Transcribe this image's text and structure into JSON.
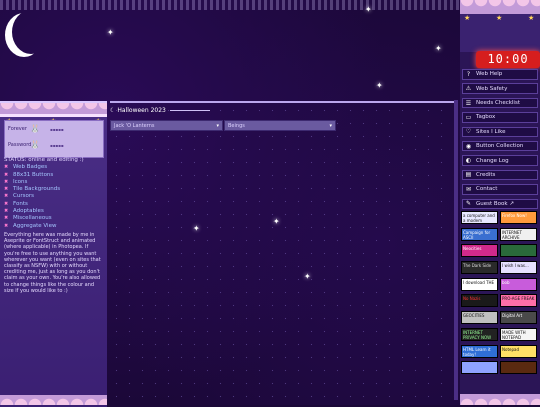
{
  "clock": "10:00 PM",
  "center": {
    "title": "Halloween 2023",
    "select_left": "Jack 'O Lanterns",
    "select_right": "Beings"
  },
  "login": {
    "user_label": "Forever",
    "pass_label": "Password"
  },
  "left_nav": {
    "status": "STATUS: online and editing :)",
    "items": [
      "Web Badges",
      "88x31 Buttons",
      "Icons",
      "Tile Backgrounds",
      "Cursors",
      "Fonts",
      "Adoptables",
      "Miscellaneous",
      "Aggregate View"
    ],
    "paragraph": "Everything here was made by me in Aseprite or FontStruct and animated (where applicable) in Photopea. If you're free to use anything you want wherever you want (even on sites that classify as NSFW) with or without crediting me, just as long as you don't claim as your own. You're also allowed to change things like the colour and size if you would like to :)"
  },
  "right_nav": [
    {
      "icon": "help-icon",
      "glyph": "?",
      "label": "Web Help"
    },
    {
      "icon": "warning-icon",
      "glyph": "⚠",
      "label": "Web Safety"
    },
    {
      "icon": "checklist-icon",
      "glyph": "☰",
      "label": "Needs Checklist"
    },
    {
      "icon": "tag-icon",
      "glyph": "▭",
      "label": "Tagbox"
    },
    {
      "icon": "heart-icon",
      "glyph": "♡",
      "label": "Sites I Like"
    },
    {
      "icon": "disc-icon",
      "glyph": "◉",
      "label": "Button Collection"
    },
    {
      "icon": "log-icon",
      "glyph": "◐",
      "label": "Change Log"
    },
    {
      "icon": "credits-icon",
      "glyph": "▤",
      "label": "Credits"
    },
    {
      "icon": "contact-icon",
      "glyph": "✉",
      "label": "Contact"
    },
    {
      "icon": "book-icon",
      "glyph": "✎",
      "label": "Guest Book ↗"
    }
  ],
  "badges": [
    [
      "a computer and a modem",
      "Firefox Now!"
    ],
    [
      "Campaign for ASCII",
      "INTERNET ARCHIVE"
    ],
    [
      "Neocities",
      ""
    ],
    [
      "The Dark Side",
      "I wish I was..."
    ],
    [
      "I download THE",
      "bob"
    ],
    [
      "No Nazis",
      "PRO-AGE FREAK"
    ],
    [
      "GEOCITIES",
      "Digital Art"
    ],
    [
      "INTERNET PRIVACY NOW",
      "MADE WITH NOTEPAD"
    ],
    [
      "HTML Learn it today!",
      "Notepad"
    ],
    [
      "",
      ""
    ]
  ],
  "colors": {
    "background": "#1b0838",
    "sidebar": "#3a1f72",
    "clock": "#d61e1e",
    "link": "#a5c6ff"
  }
}
